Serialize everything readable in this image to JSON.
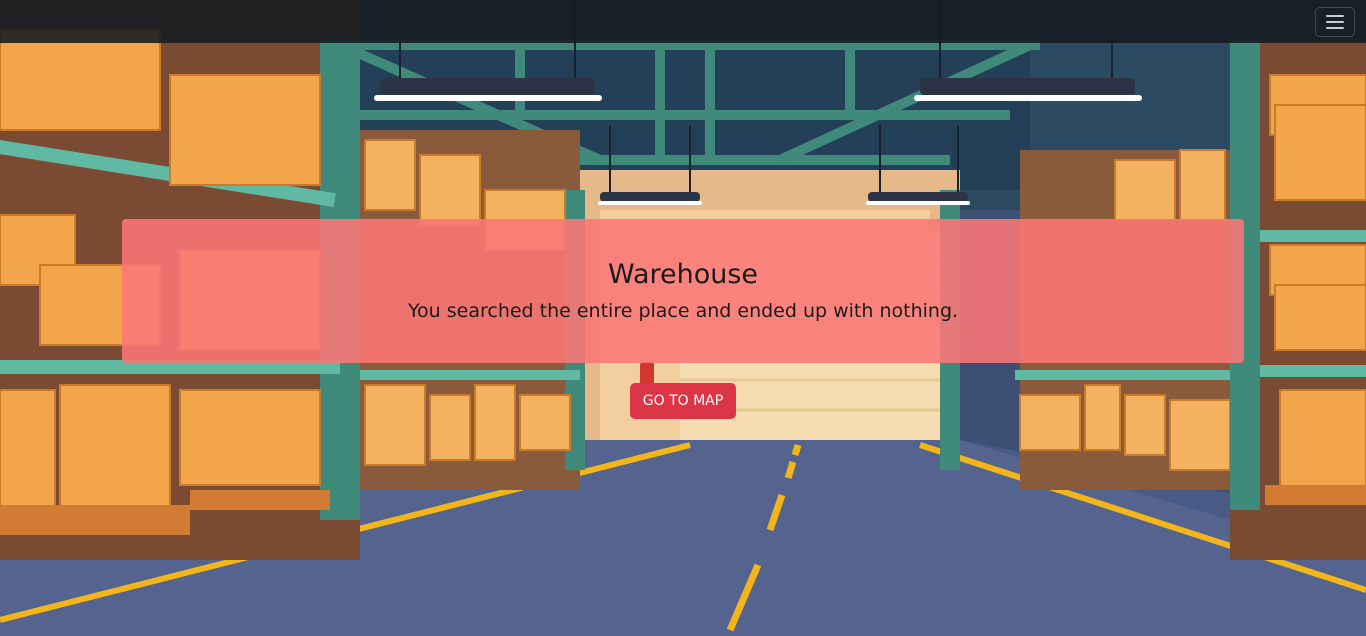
{
  "navbar": {
    "menu_icon": "hamburger-menu-icon"
  },
  "background": {
    "description_icon": "warehouse-scene"
  },
  "panel": {
    "title": "Warehouse",
    "message": "You searched the entire place and ended up with nothing."
  },
  "actions": {
    "go_to_map_label": "GO TO MAP"
  },
  "colors": {
    "panel": "#fc7676",
    "button": "#dc3545",
    "navbar": "#141a20"
  }
}
